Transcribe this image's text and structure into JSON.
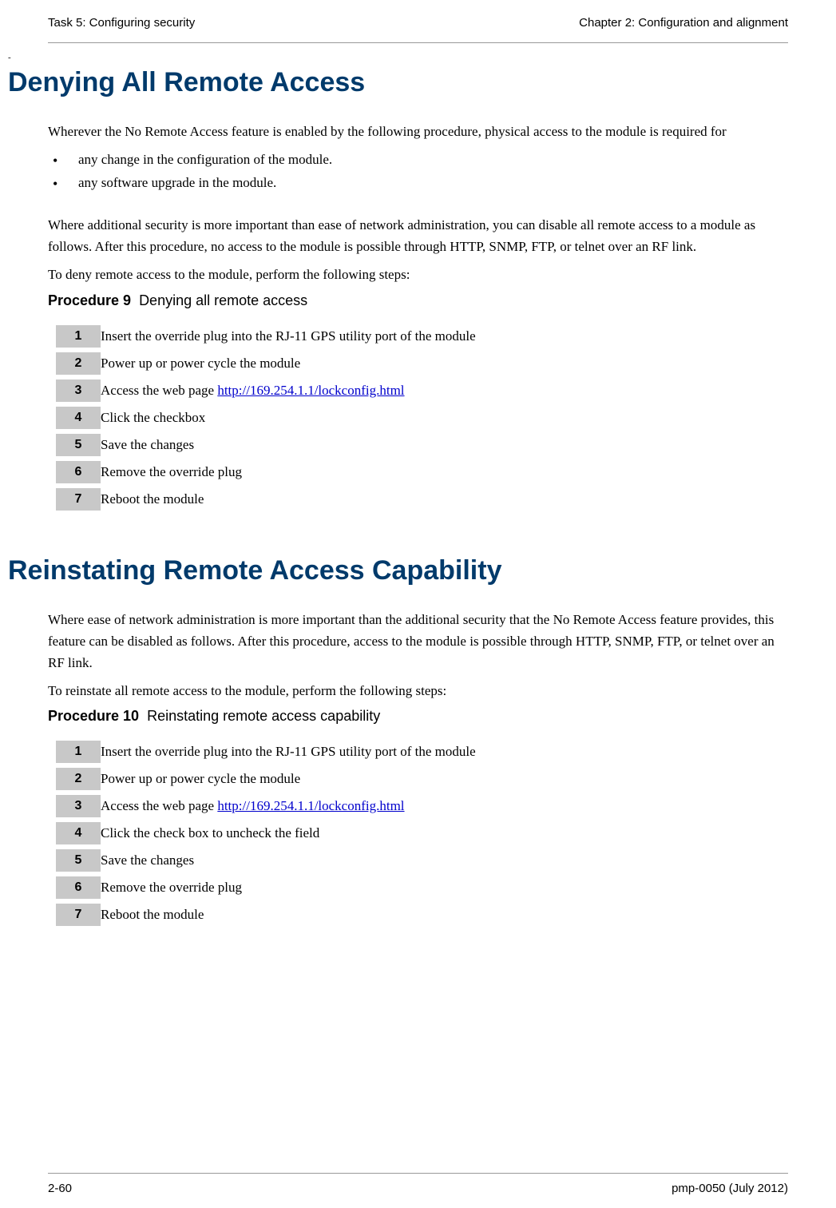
{
  "header": {
    "left": "Task 5: Configuring security",
    "right": "Chapter 2:  Configuration and alignment"
  },
  "dash": "-",
  "section1": {
    "title": "Denying All Remote Access",
    "intro": "Wherever the No Remote Access feature is enabled by the following procedure, physical access to the module is required for",
    "bullets": [
      "any change in the configuration of the module.",
      "any software upgrade in the module."
    ],
    "para2": "Where additional security is more important than ease of network administration, you can disable all remote access to a module as follows.  After this procedure, no access to the module is possible through HTTP, SNMP, FTP, or telnet over an RF link.",
    "para3": "To deny remote access to the module, perform the following steps:",
    "procLabel": "Procedure 9",
    "procTitle": "Denying all remote access",
    "steps": [
      {
        "n": "1",
        "text": "Insert the override plug into the RJ-11 GPS utility port of the module"
      },
      {
        "n": "2",
        "text": "Power up or power cycle the module"
      },
      {
        "n": "3",
        "prefix": "Access the web page ",
        "link": "http://169.254.1.1/lockconfig.html"
      },
      {
        "n": "4",
        "text": "Click the checkbox"
      },
      {
        "n": "5",
        "text": "Save the changes"
      },
      {
        "n": "6",
        "text": "Remove the override plug"
      },
      {
        "n": "7",
        "text": "Reboot the module"
      }
    ]
  },
  "section2": {
    "title": "Reinstating Remote Access Capability",
    "para1": "Where ease of network administration is more important than the additional security that the No Remote Access feature provides, this feature can be disabled as follows.  After this procedure, access to the module is possible through HTTP, SNMP, FTP, or telnet over an RF link.",
    "para2": "To reinstate all remote access to the module, perform the following steps:",
    "procLabel": "Procedure 10",
    "procTitle": "Reinstating remote access capability",
    "steps": [
      {
        "n": "1",
        "text": "Insert the override plug into the RJ-11 GPS utility port of the module"
      },
      {
        "n": "2",
        "text": "Power up or power cycle the module"
      },
      {
        "n": "3",
        "prefix": "Access the web page ",
        "link": "http://169.254.1.1/lockconfig.html"
      },
      {
        "n": "4",
        "text": "Click the check box to uncheck the field"
      },
      {
        "n": "5",
        "text": "Save the changes"
      },
      {
        "n": "6",
        "text": "Remove the override plug"
      },
      {
        "n": "7",
        "text": "Reboot the module"
      }
    ]
  },
  "footer": {
    "left": "2-60",
    "right": "pmp-0050 (July 2012)"
  }
}
